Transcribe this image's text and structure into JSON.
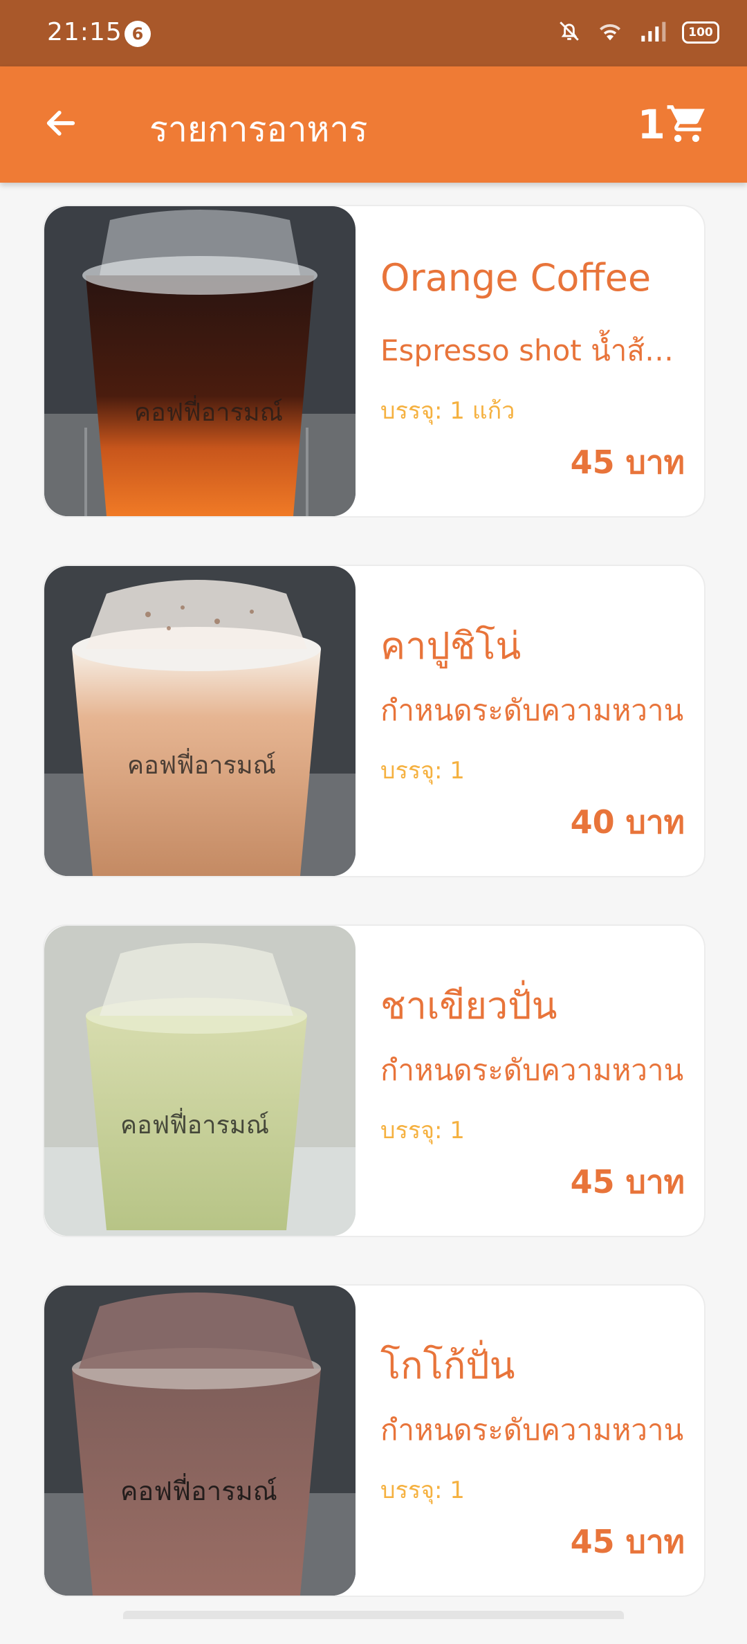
{
  "status": {
    "time": "21:15",
    "notification_count": "6",
    "battery": "100"
  },
  "app_bar": {
    "title": "รายการอาหาร",
    "cart_count": "1"
  },
  "items": [
    {
      "name": "Orange Coffee",
      "description": "Espresso shot   น้ำส้มคั้น",
      "pack": "บรรจุ: 1 แก้ว",
      "price": "45 บาท"
    },
    {
      "name": "คาปูชิโน่",
      "description": "กำหนดระดับความหวาน",
      "pack": "บรรจุ: 1",
      "price": "40 บาท"
    },
    {
      "name": "ชาเขียวปั่น",
      "description": "กำหนดระดับความหวาน",
      "pack": "บรรจุ: 1",
      "price": "45 บาท"
    },
    {
      "name": "โกโก้ปั่น",
      "description": "กำหนดระดับความหวาน",
      "pack": "บรรจุ: 1",
      "price": "45 บาท"
    }
  ],
  "icons": {
    "back": "arrow-left-icon",
    "cart": "shopping-cart-icon",
    "mute": "bell-off-icon",
    "wifi": "wifi-icon",
    "signal": "signal-icon",
    "battery": "battery-icon"
  },
  "colors": {
    "status_bar": "#a9582a",
    "app_bar": "#ef7b35",
    "accent_text": "#e8743a",
    "pack_text": "#f5b140"
  }
}
